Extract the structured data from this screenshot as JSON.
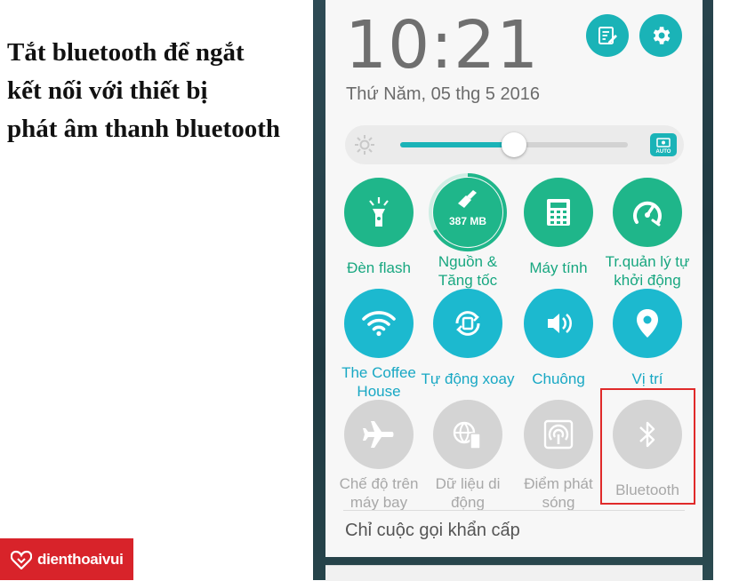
{
  "caption": {
    "line1": "Tắt bluetooth để ngắt",
    "line2": "kết nối với thiết bị",
    "line3": "phát âm thanh bluetooth"
  },
  "logo": {
    "text": "dienthoaivui",
    "color": "#d8232a"
  },
  "status": {
    "time": "10:21",
    "date": "Thứ Năm, 05 thg 5 2016"
  },
  "top_buttons": [
    {
      "icon": "edit-note-icon"
    },
    {
      "icon": "gear-icon"
    }
  ],
  "brightness": {
    "level_percent": 50,
    "auto_label": "AUTO"
  },
  "tiles": [
    {
      "label1": "Đèn flash",
      "label2": "",
      "icon": "flashlight-icon",
      "state": "on"
    },
    {
      "label1": "Nguồn &",
      "label2": "Tăng tốc",
      "icon": "broom-icon",
      "badge": "387 MB",
      "state": "on"
    },
    {
      "label1": "Máy tính",
      "label2": "",
      "icon": "calculator-icon",
      "state": "on"
    },
    {
      "label1": "Tr.quản lý tự",
      "label2": "khởi động",
      "icon": "speedometer-icon",
      "state": "on"
    },
    {
      "label1": "The Coffee",
      "label2": "House",
      "icon": "wifi-icon",
      "state": "on"
    },
    {
      "label1": "Tự động xoay",
      "label2": "",
      "icon": "auto-rotate-icon",
      "state": "on"
    },
    {
      "label1": "Chuông",
      "label2": "",
      "icon": "ring-volume-icon",
      "state": "on"
    },
    {
      "label1": "Vị trí",
      "label2": "",
      "icon": "location-pin-icon",
      "state": "on"
    },
    {
      "label1": "Chế độ trên",
      "label2": "máy bay",
      "icon": "airplane-icon",
      "state": "off"
    },
    {
      "label1": "Dữ liệu di",
      "label2": "động",
      "icon": "mobile-data-icon",
      "state": "off"
    },
    {
      "label1": "Điểm phát",
      "label2": "sóng",
      "icon": "hotspot-icon",
      "state": "off"
    },
    {
      "label1": "Bluetooth",
      "label2": "",
      "icon": "bluetooth-icon",
      "state": "off"
    }
  ],
  "emergency": "Chỉ cuộc gọi khẩn cấp",
  "colors": {
    "accent_teal": "#1ab3b7",
    "tile_green": "#1fb68a",
    "tile_blue": "#1cb9cf",
    "highlight_red": "#e02a2a"
  }
}
